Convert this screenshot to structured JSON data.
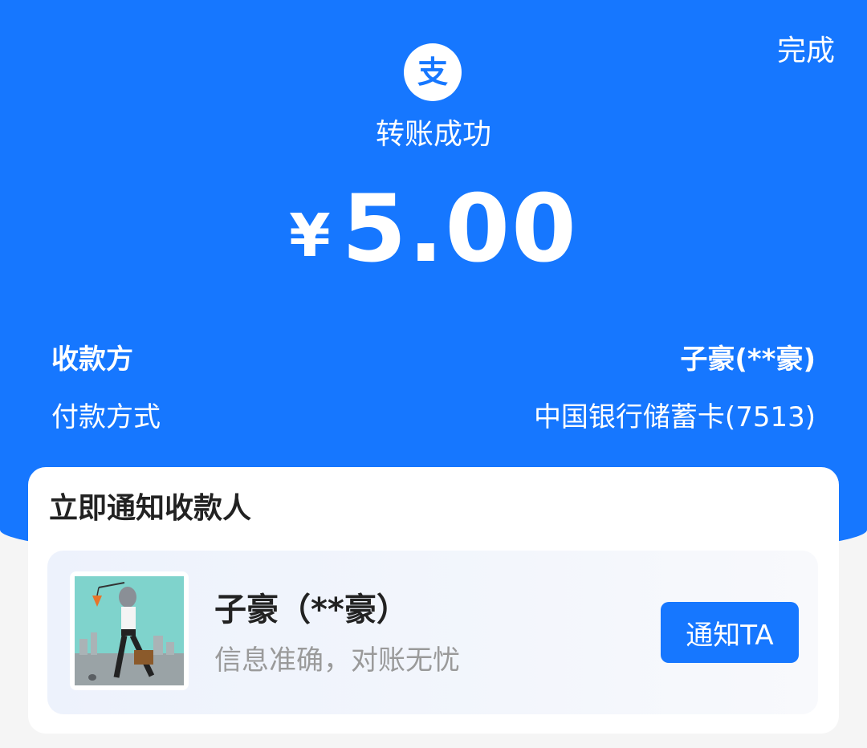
{
  "header": {
    "done_label": "完成",
    "status_text": "转账成功"
  },
  "amount": {
    "currency_symbol": "¥",
    "value": "5.00"
  },
  "details": {
    "payee_label": "收款方",
    "payee_value": "子豪(**豪)",
    "payment_method_label": "付款方式",
    "payment_method_value": "中国银行储蓄卡(7513)"
  },
  "notify_card": {
    "title": "立即通知收款人",
    "recipient_name": "子豪（**豪）",
    "subtitle": "信息准确，对账无忧",
    "button_label": "通知TA"
  },
  "colors": {
    "brand_blue": "#1677ff",
    "background": "#f5f5f5",
    "muted_text": "#9a9a9a"
  },
  "icons": {
    "logo": "alipay-logo-icon"
  }
}
